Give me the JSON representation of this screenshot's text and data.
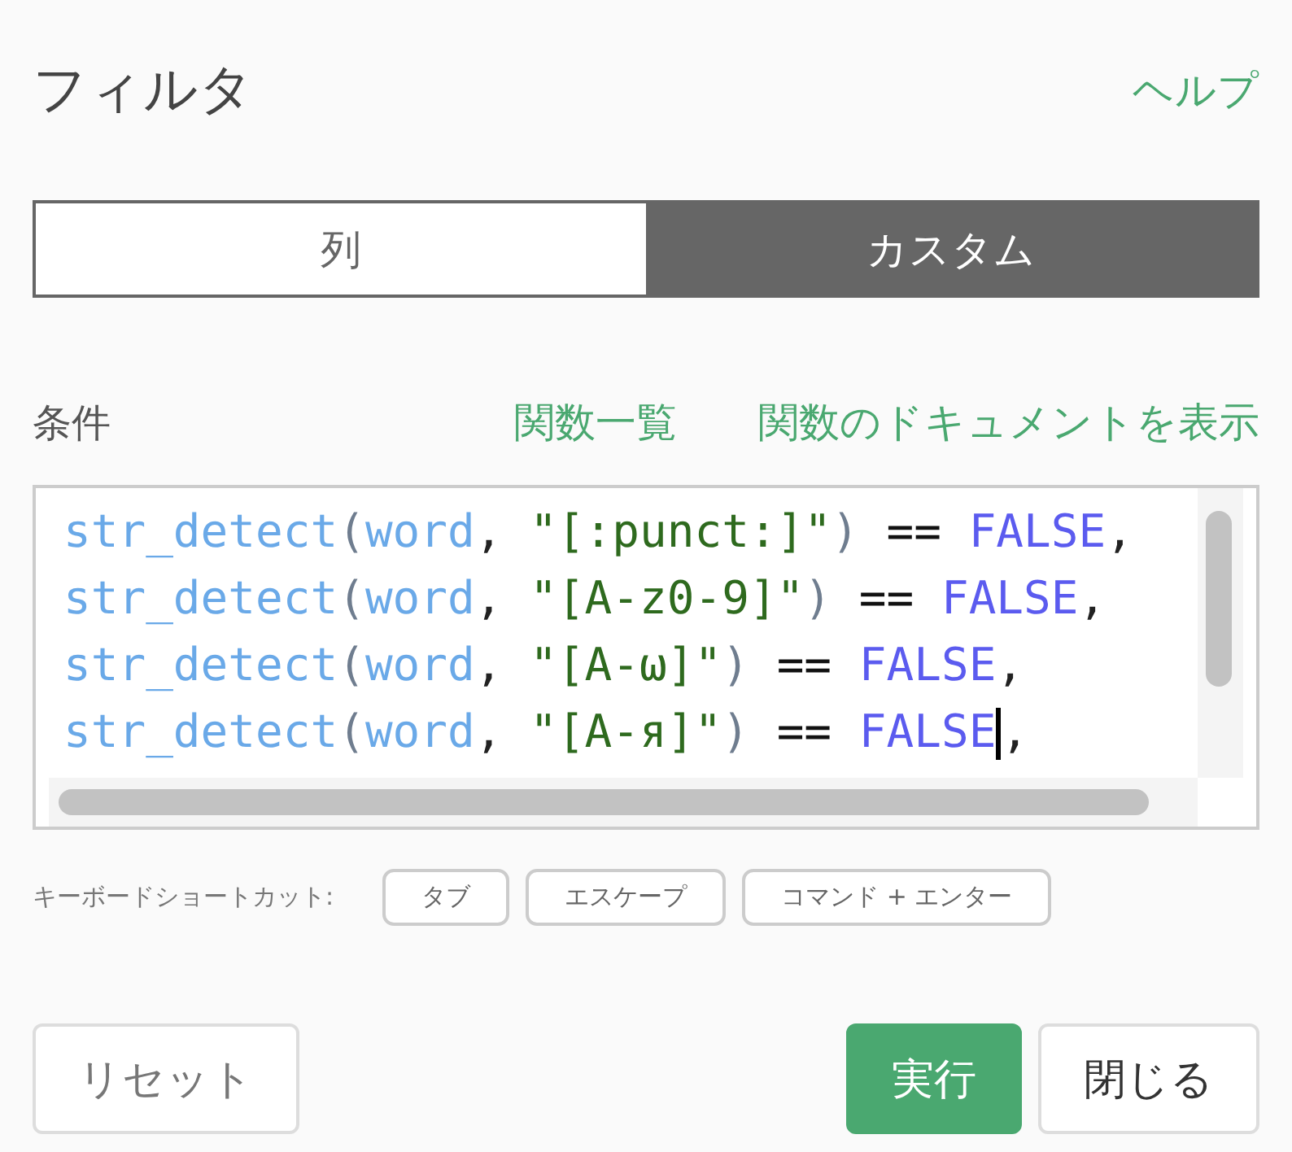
{
  "header": {
    "title": "フィルタ",
    "help_link": "ヘルプ"
  },
  "tabs": [
    {
      "label": "列",
      "selected": false
    },
    {
      "label": "カスタム",
      "selected": true
    }
  ],
  "condition": {
    "label": "条件",
    "links": [
      "関数一覧",
      "関数のドキュメントを表示"
    ]
  },
  "editor": {
    "lines": [
      {
        "cursor": false,
        "tokens": [
          {
            "kind": "fn",
            "text": "str_detect"
          },
          {
            "kind": "paren",
            "text": "("
          },
          {
            "kind": "arg",
            "text": "word"
          },
          {
            "kind": "punct",
            "text": ", "
          },
          {
            "kind": "string",
            "text": "\"[:punct:]\""
          },
          {
            "kind": "paren",
            "text": ")"
          },
          {
            "kind": "op",
            "text": " == "
          },
          {
            "kind": "const",
            "text": "FALSE"
          },
          {
            "kind": "punct",
            "text": ","
          }
        ]
      },
      {
        "cursor": false,
        "tokens": [
          {
            "kind": "fn",
            "text": "str_detect"
          },
          {
            "kind": "paren",
            "text": "("
          },
          {
            "kind": "arg",
            "text": "word"
          },
          {
            "kind": "punct",
            "text": ", "
          },
          {
            "kind": "string",
            "text": "\"[A-z0-9]\""
          },
          {
            "kind": "paren",
            "text": ")"
          },
          {
            "kind": "op",
            "text": " == "
          },
          {
            "kind": "const",
            "text": "FALSE"
          },
          {
            "kind": "punct",
            "text": ","
          }
        ]
      },
      {
        "cursor": false,
        "tokens": [
          {
            "kind": "fn",
            "text": "str_detect"
          },
          {
            "kind": "paren",
            "text": "("
          },
          {
            "kind": "arg",
            "text": "word"
          },
          {
            "kind": "punct",
            "text": ", "
          },
          {
            "kind": "string",
            "text": "\"[A-ω]\""
          },
          {
            "kind": "paren",
            "text": ")"
          },
          {
            "kind": "op",
            "text": " == "
          },
          {
            "kind": "const",
            "text": "FALSE"
          },
          {
            "kind": "punct",
            "text": ","
          }
        ]
      },
      {
        "cursor": true,
        "tokens": [
          {
            "kind": "fn",
            "text": "str_detect"
          },
          {
            "kind": "paren",
            "text": "("
          },
          {
            "kind": "arg",
            "text": "word"
          },
          {
            "kind": "punct",
            "text": ", "
          },
          {
            "kind": "string",
            "text": "\"[A-я]\""
          },
          {
            "kind": "paren",
            "text": ")"
          },
          {
            "kind": "op",
            "text": " == "
          },
          {
            "kind": "const",
            "text": "FALSE"
          },
          {
            "kind": "punct",
            "text": ","
          }
        ]
      }
    ]
  },
  "shortcuts": {
    "label": "キーボードショートカット:",
    "keys": [
      "タブ",
      "エスケープ",
      "コマンド + エンター"
    ]
  },
  "footer": {
    "reset": "リセット",
    "buttons": [
      {
        "kind": "primary",
        "label": "実行"
      },
      {
        "kind": "default",
        "label": "閉じる"
      }
    ]
  }
}
